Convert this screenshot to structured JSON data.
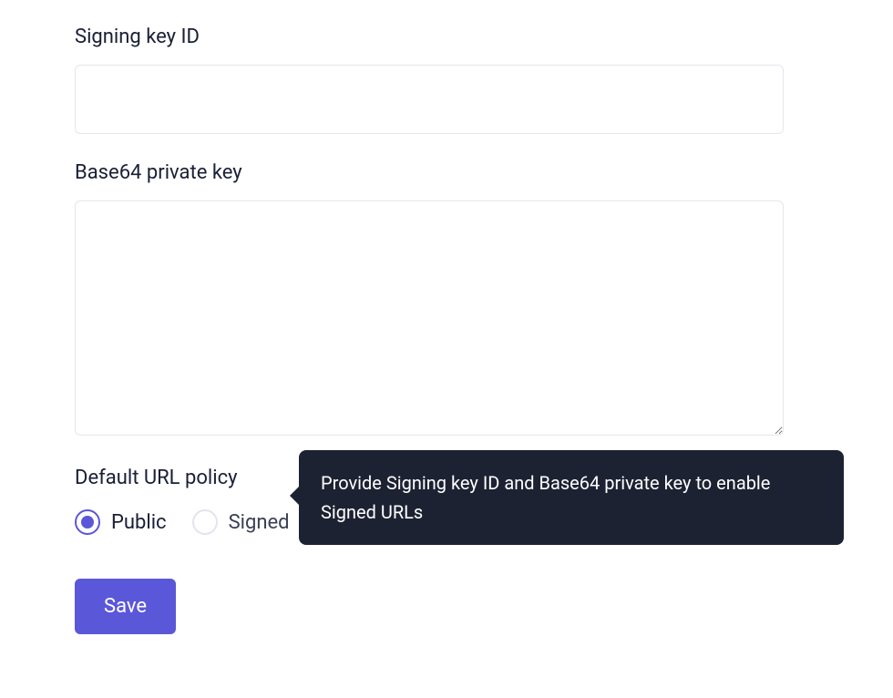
{
  "fields": {
    "signing_key_id": {
      "label": "Signing key ID",
      "value": ""
    },
    "base64_private_key": {
      "label": "Base64 private key",
      "value": ""
    }
  },
  "url_policy": {
    "label": "Default URL policy",
    "options": {
      "public": "Public",
      "signed": "Signed"
    },
    "selected": "public"
  },
  "tooltip": {
    "text": "Provide Signing key ID and Base64 private key to enable Signed URLs"
  },
  "buttons": {
    "save": "Save"
  }
}
